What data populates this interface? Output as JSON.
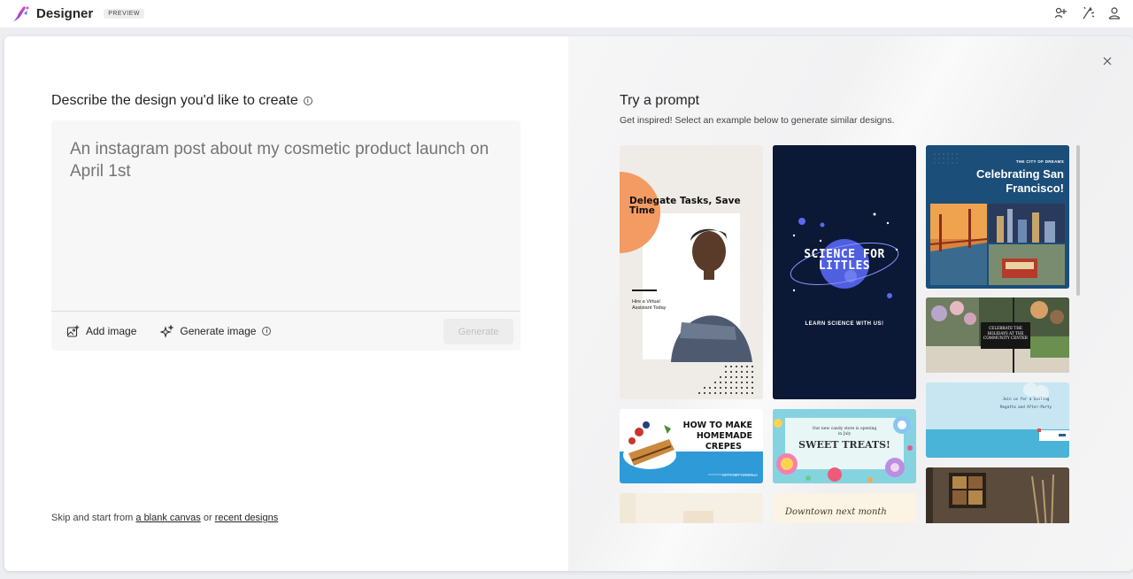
{
  "app": {
    "name": "Designer",
    "badge": "PREVIEW",
    "icons": [
      "share-icon",
      "ideas-icon",
      "account-icon"
    ]
  },
  "left": {
    "heading": "Describe the design you'd like to create",
    "prompt_placeholder": "An instagram post about my cosmetic product launch on April 1st",
    "add_image_label": "Add image",
    "generate_image_label": "Generate image",
    "generate_button": "Generate",
    "skip_prefix": "Skip and start from",
    "blank_canvas_link": "a blank canvas",
    "skip_or": "or",
    "recent_designs_link": "recent designs"
  },
  "right": {
    "title": "Try a prompt",
    "subtitle": "Get inspired! Select an example below to generate similar designs."
  },
  "cards": {
    "delegate": {
      "title": "Delegate Tasks, Save Time",
      "sub": "Hire a Virtual Assistant Today"
    },
    "science": {
      "title1": "SCIENCE FOR",
      "title2": "LITTLES",
      "sub": "LEARN SCIENCE WITH US!"
    },
    "sf": {
      "kicker": "THE CITY OF DREAMS",
      "title1": "Celebrating San",
      "title2": "Francisco!"
    },
    "holiday": {
      "text": "CELEBRATE THE HOLIDAYS AT THE COMMUNITY CENTER"
    },
    "crepes": {
      "title1": "HOW TO MAKE",
      "title2": "HOMEMADE",
      "title3": "CREPES",
      "sub": "LET'S GET COOKING"
    },
    "candy": {
      "sub": "Our new candy store is opening in July",
      "title": "SWEET TREATS!"
    },
    "sailing": {
      "text1": "Join us for a Sailing",
      "text2": "Regatta and After-Party"
    },
    "card11": {
      "text": "Downtown next month"
    }
  }
}
